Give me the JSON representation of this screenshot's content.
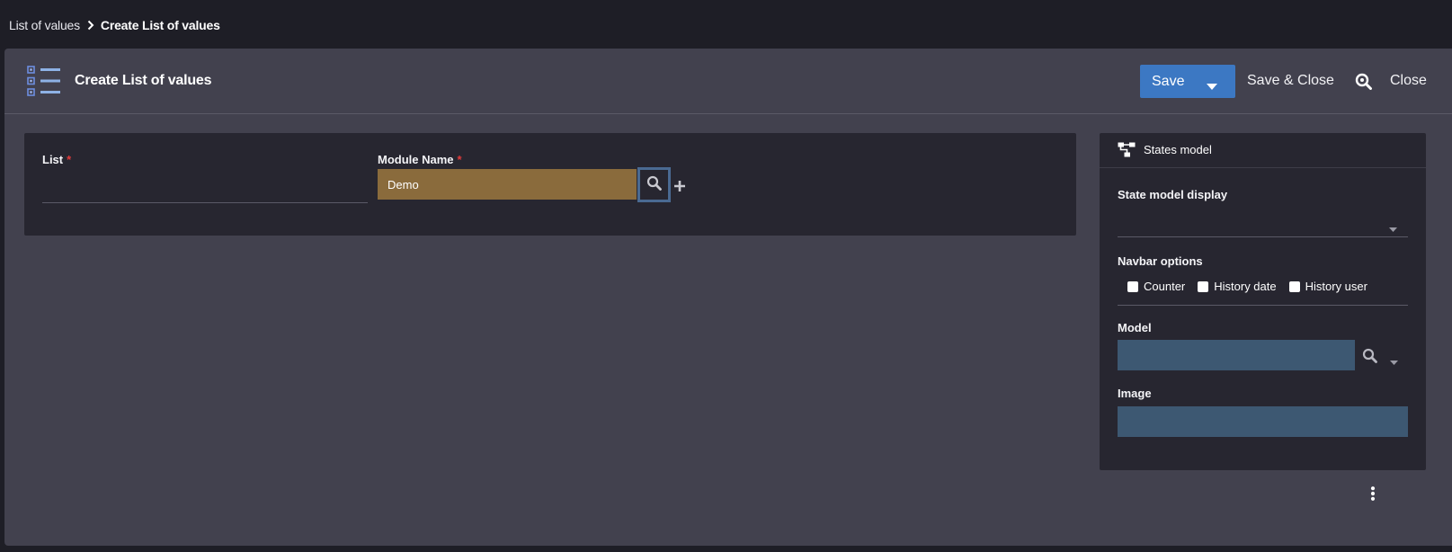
{
  "breadcrumb": {
    "parent": "List of values",
    "current": "Create List of values"
  },
  "header": {
    "title": "Create List of values",
    "save_label": "Save",
    "save_close_label": "Save & Close",
    "close_label": "Close"
  },
  "form": {
    "list_label": "List",
    "list_value": "",
    "module_label": "Module Name",
    "module_value": "Demo",
    "required_mark": "*"
  },
  "side_panel": {
    "title": "States model",
    "state_model_display_label": "State model display",
    "state_model_display_value": "",
    "navbar_options_label": "Navbar options",
    "navbar_options": [
      {
        "label": "Counter",
        "checked": false
      },
      {
        "label": "History date",
        "checked": false
      },
      {
        "label": "History user",
        "checked": false
      }
    ],
    "model_label": "Model",
    "model_value": "",
    "image_label": "Image",
    "image_value": ""
  },
  "colors": {
    "page_bg": "#1e1e26",
    "panel_bg": "#42414e",
    "card_bg": "#272630",
    "accent_blue": "#3c78c3",
    "module_field_bg": "#8a6b3c",
    "input_blue": "#3d5872",
    "required_red": "#e23b3b"
  },
  "icons": {
    "breadcrumb_separator": "chevron-right-icon",
    "header": "list-icon",
    "save_dropdown": "caret-down-icon",
    "find": "zoom-search-icon",
    "module_search": "search-icon",
    "module_add": "plus-icon",
    "states_model": "hierarchy-icon",
    "more": "kebab-menu-icon"
  }
}
